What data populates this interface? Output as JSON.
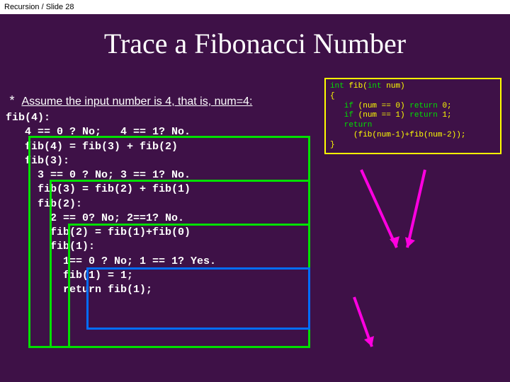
{
  "header": "Recursion / Slide 28",
  "title": "Trace a Fibonacci Number",
  "assume_marker": "*",
  "assume": "Assume the input number is 4, that is, num=4:",
  "code": {
    "l1a": "int",
    "l1b": " fib(",
    "l1c": "int",
    "l1d": " num)",
    "l2": "{",
    "l3a": "   if",
    "l3b": " (num == 0) ",
    "l3c": "return",
    "l3d": " 0;",
    "l4a": "   if",
    "l4b": " (num == 1) ",
    "l4c": "return",
    "l4d": " 1;",
    "l5a": "   return",
    "l6": "     (fib(num-1)+fib(num-2));",
    "l7": "}"
  },
  "trace": {
    "t1": "fib(4):",
    "t2": "   4 == 0 ? No;   4 == 1? No.",
    "t3": "   fib(4) = fib(3) + fib(2)",
    "t4": "   fib(3):",
    "t5": "     3 == 0 ? No; 3 == 1? No.",
    "t6": "     fib(3) = fib(2) + fib(1)",
    "t7": "     fib(2):",
    "t8": "       2 == 0? No; 2==1? No.",
    "t9": "       fib(2) = fib(1)+fib(0)",
    "t10": "       fib(1):",
    "t11": "         1== 0 ? No; 1 == 1? Yes.",
    "t12": "         fib(1) = 1;",
    "t13": "         return fib(1);"
  },
  "chart_data": {
    "type": "table",
    "title": "Recursive Fibonacci trace for num=4",
    "function": "int fib(int num){ if(num==0) return 0; if(num==1) return 1; return fib(num-1)+fib(num-2); }",
    "call_stack_shown": [
      {
        "call": "fib(4)",
        "check0": false,
        "check1": false,
        "expands_to": "fib(3) + fib(2)"
      },
      {
        "call": "fib(3)",
        "check0": false,
        "check1": false,
        "expands_to": "fib(2) + fib(1)"
      },
      {
        "call": "fib(2)",
        "check0": false,
        "check1": false,
        "expands_to": "fib(1) + fib(0)"
      },
      {
        "call": "fib(1)",
        "check0": false,
        "check1": true,
        "returns": 1
      }
    ],
    "box_colors": {
      "fib4": "#00e000",
      "fib3": "#00e000",
      "fib2": "#00e000",
      "fib1": "#006eff"
    },
    "arrow_color": "#ff00e0"
  }
}
